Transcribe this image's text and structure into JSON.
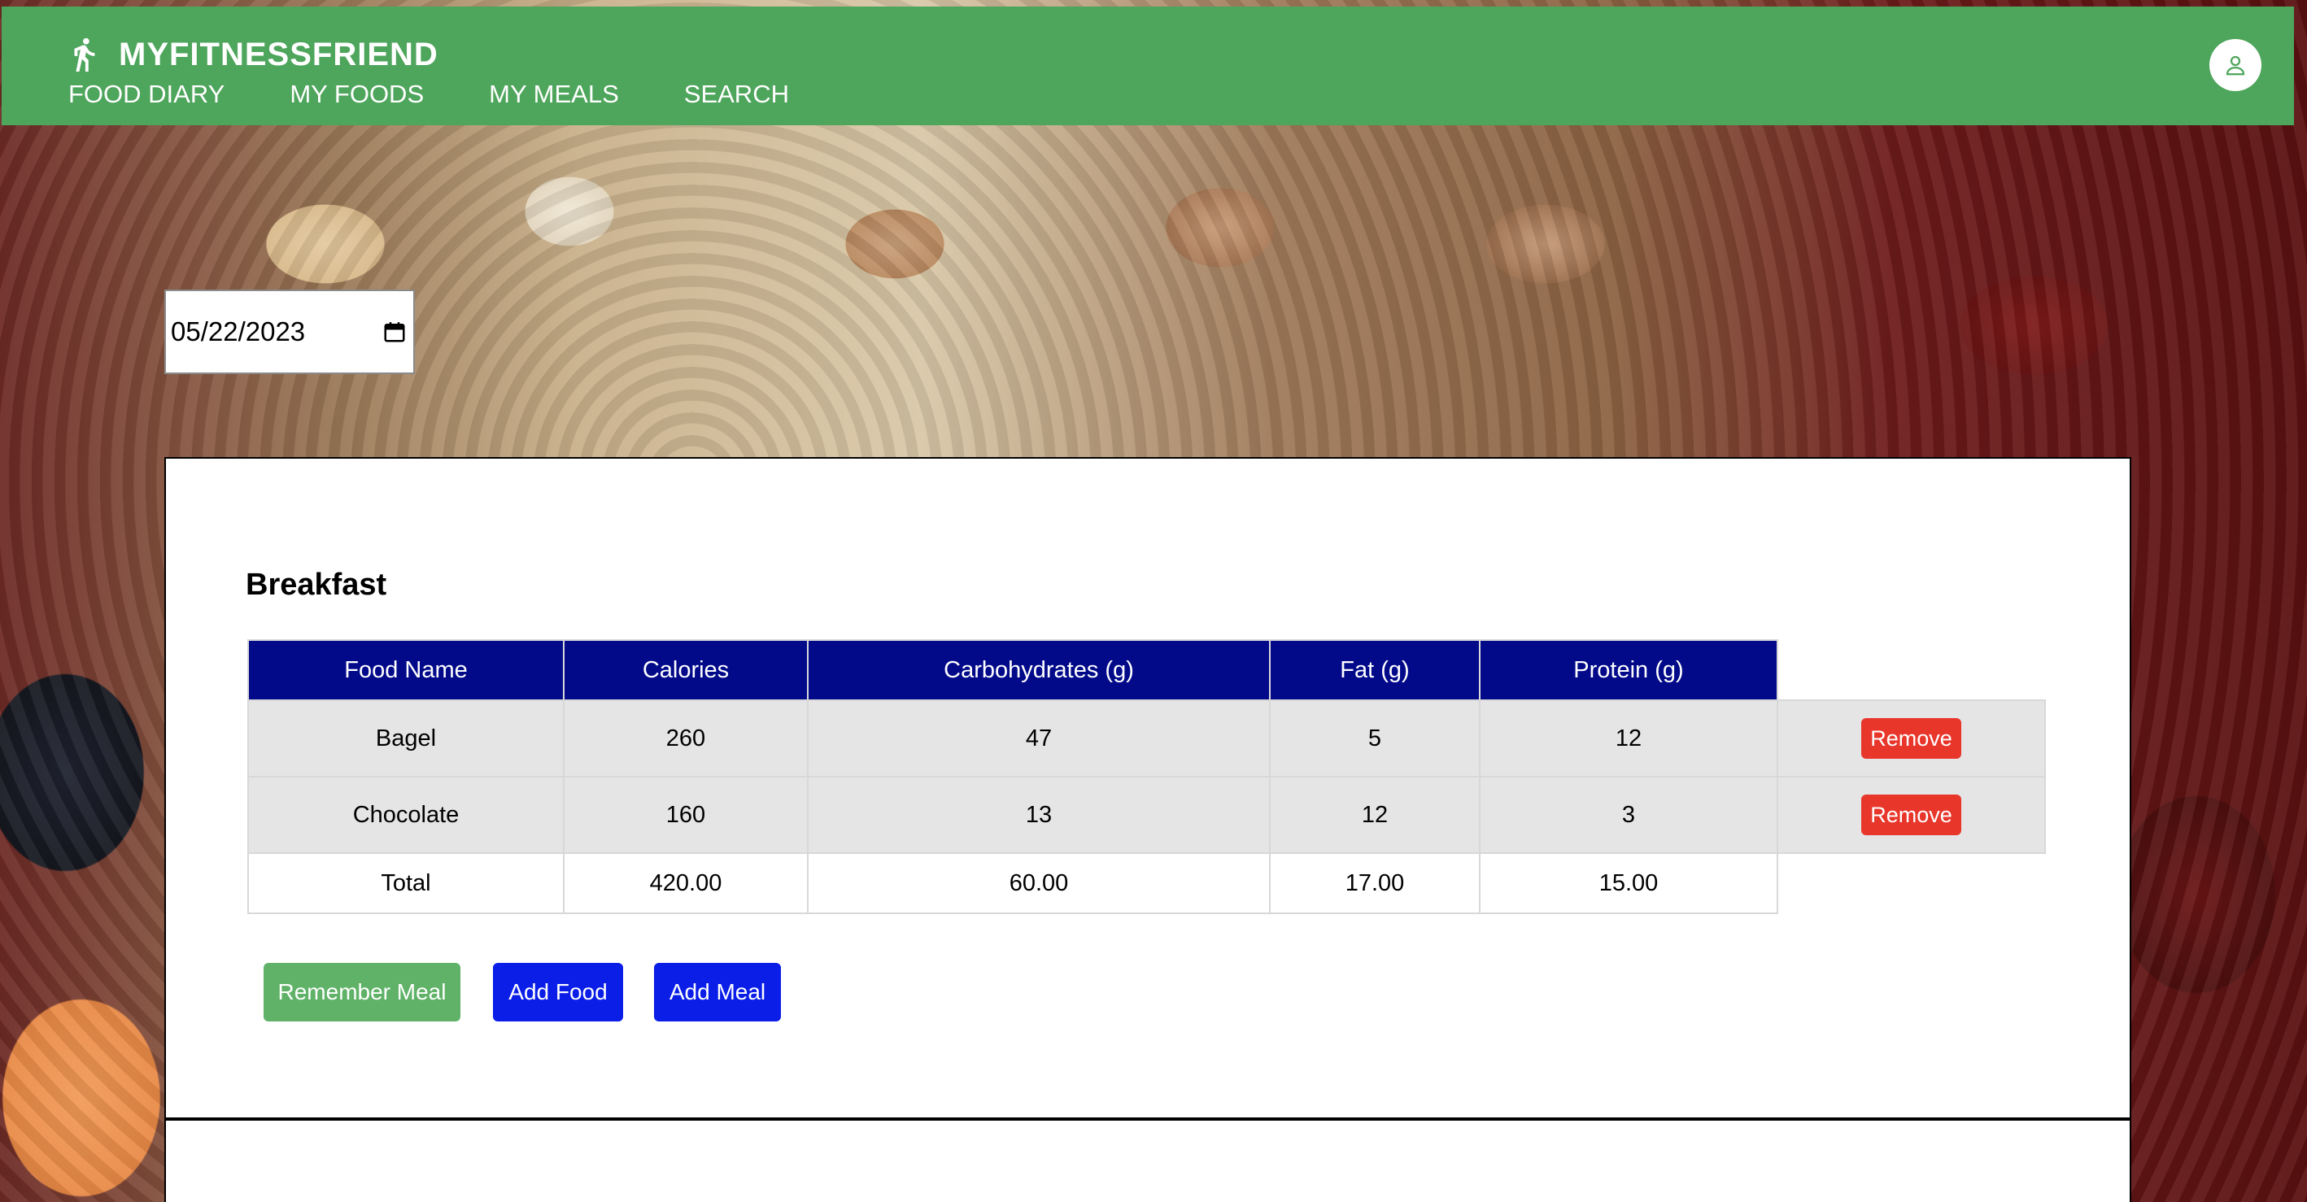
{
  "app": {
    "brand_name": "MYFITNESSFRIEND",
    "brand_icon": "running-person-icon",
    "profile_icon": "user-icon"
  },
  "nav": {
    "items": [
      {
        "label": "FOOD DIARY"
      },
      {
        "label": "MY FOODS"
      },
      {
        "label": "MY MEALS"
      },
      {
        "label": "SEARCH"
      }
    ]
  },
  "date_picker": {
    "value": "05/22/2023",
    "icon": "calendar-icon"
  },
  "meal": {
    "title": "Breakfast",
    "columns": [
      "Food Name",
      "Calories",
      "Carbohydrates (g)",
      "Fat (g)",
      "Protein (g)"
    ],
    "rows": [
      {
        "name": "Bagel",
        "calories": "260",
        "carbs": "47",
        "fat": "5",
        "protein": "12",
        "action": "Remove"
      },
      {
        "name": "Chocolate",
        "calories": "160",
        "carbs": "13",
        "fat": "12",
        "protein": "3",
        "action": "Remove"
      }
    ],
    "total": {
      "label": "Total",
      "calories": "420.00",
      "carbs": "60.00",
      "fat": "17.00",
      "protein": "15.00"
    }
  },
  "actions": {
    "remember_meal": "Remember Meal",
    "add_food": "Add Food",
    "add_meal": "Add Meal"
  },
  "colors": {
    "header": "#4ea55c",
    "table_header": "#020a8a",
    "remove": "#e8362b",
    "primary_button": "#0a1ee8",
    "remember_button": "#5fb267"
  }
}
